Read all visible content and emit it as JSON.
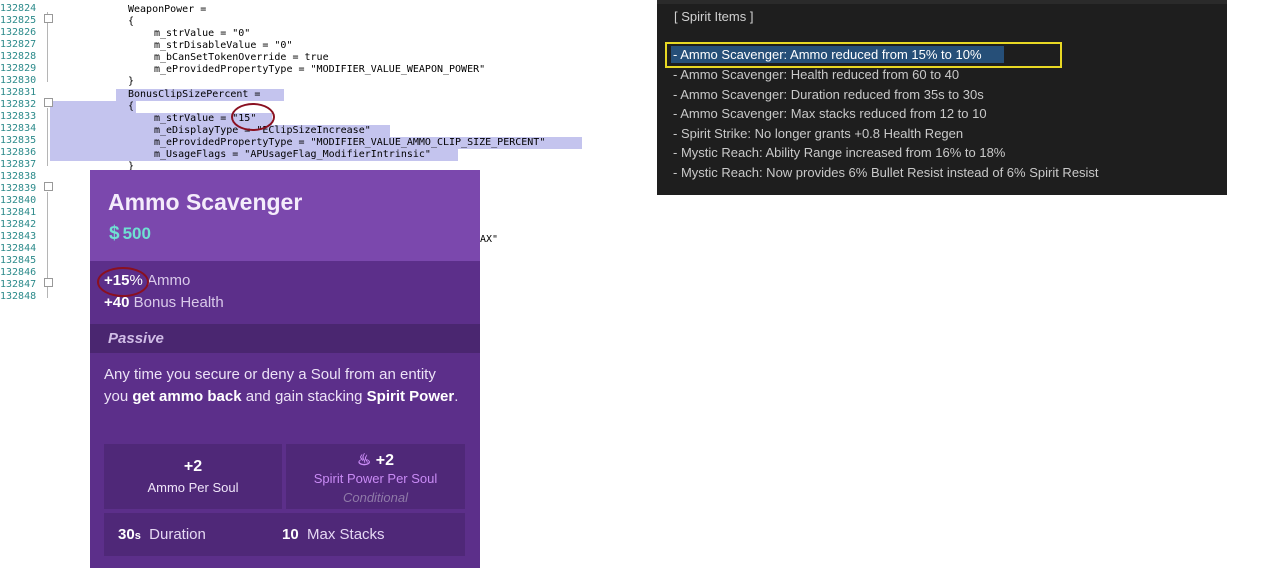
{
  "editor": {
    "line_numbers": [
      "132824",
      "132825",
      "132826",
      "132827",
      "132828",
      "132829",
      "132830",
      "132831",
      "132832",
      "132833",
      "132834",
      "132835",
      "132836",
      "132837",
      "132838",
      "132839",
      "132840",
      "132841",
      "132842",
      "132843",
      "132844",
      "132845",
      "132846",
      "132847",
      "132848"
    ],
    "lines": [
      "WeaponPower =",
      "{",
      "m_strValue = \"0\"",
      "m_strDisableValue = \"0\"",
      "m_bCanSetTokenOverride = true",
      "m_eProvidedPropertyType = \"MODIFIER_VALUE_WEAPON_POWER\"",
      "}",
      "BonusClipSizePercent =",
      "{",
      "m_strValue = \"15\"",
      "m_eDisplayType = \"EClipSizeIncrease\"",
      "m_eProvidedPropertyType = \"MODIFIER_VALUE_AMMO_CLIP_SIZE_PERCENT\"",
      "m_UsageFlags = \"APUsageFlag_ModifierIntrinsic\"",
      "}"
    ],
    "fragment": "AX\""
  },
  "notes": {
    "header": "[ Spirit Items ]",
    "items": [
      "- Ammo Scavenger: Ammo reduced from 15% to 10%",
      "- Ammo Scavenger: Health reduced from 60 to 40",
      "- Ammo Scavenger: Duration reduced from 35s to 30s",
      "- Ammo Scavenger: Max stacks reduced from 12 to 10",
      "- Spirit Strike: No longer grants +0.8 Health Regen",
      "- Mystic Reach: Ability Range increased from 16% to 18%",
      "- Mystic Reach: Now provides 6% Bullet Resist instead of 6% Spirit Resist"
    ]
  },
  "card": {
    "title": "Ammo Scavenger",
    "price": "500",
    "price_icon": "soul-icon",
    "stats": [
      {
        "value": "+15",
        "unit": "%",
        "label": "Ammo"
      },
      {
        "value": "+40",
        "unit": "",
        "label": "Bonus Health"
      }
    ],
    "passive": "Passive",
    "desc": {
      "p1": "Any time you secure or deny a Soul from an entity you ",
      "b1": "get ammo back",
      "p2": " and gain stacking ",
      "b2": "Spirit Power",
      "p3": "."
    },
    "cells": {
      "ammo": {
        "value": "+2",
        "label": "Ammo Per Soul"
      },
      "spirit": {
        "value": "+2",
        "label": "Spirit Power Per Soul",
        "cond": "Conditional",
        "icon": "spirit-flame-icon"
      },
      "duration": {
        "num": "30",
        "unit": "s",
        "label": "Duration"
      },
      "stacks": {
        "num": "10",
        "label": "Max Stacks"
      }
    }
  },
  "colors": {
    "card_bg": "#5c2f8a",
    "card_header": "#7b48ad",
    "price": "#6fe0d2",
    "note_highlight": "#e8d824",
    "circle": "#8a1020"
  }
}
